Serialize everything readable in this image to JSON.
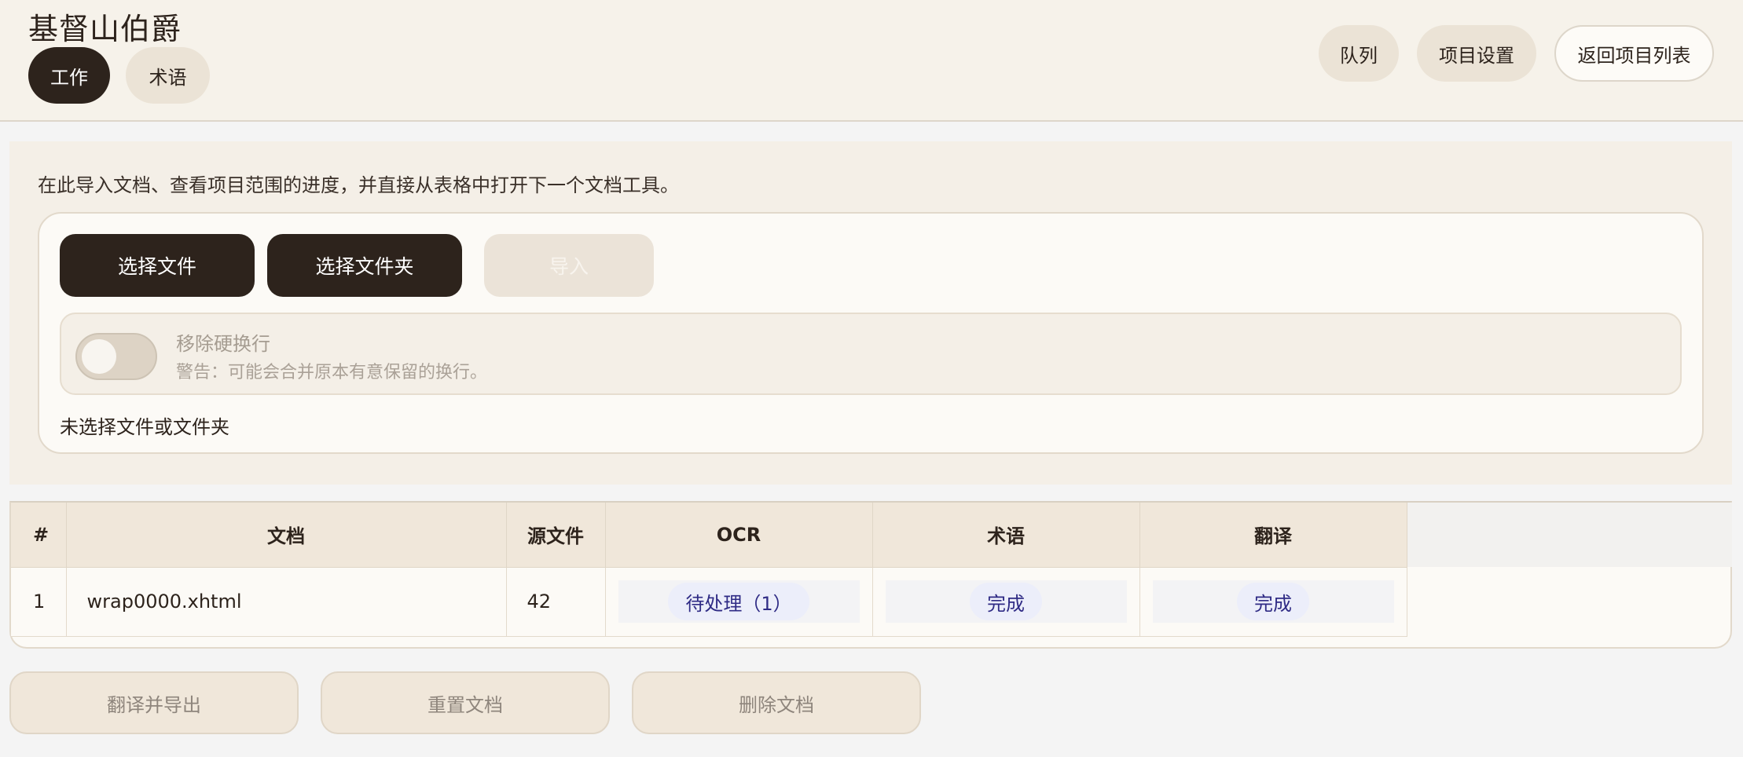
{
  "header": {
    "project_title": "基督山伯爵",
    "tabs": [
      {
        "label": "工作",
        "active": true
      },
      {
        "label": "术语",
        "active": false
      }
    ],
    "buttons": {
      "queue": "队列",
      "project_settings": "项目设置",
      "back_to_list": "返回项目列表"
    }
  },
  "import_panel": {
    "intro": "在此导入文档、查看项目范围的进度，并直接从表格中打开下一个文档工具。",
    "choose_files": "选择文件",
    "choose_folder": "选择文件夹",
    "import": "导入",
    "option": {
      "title": "移除硬换行",
      "warning": "警告：可能会合并原本有意保留的换行。",
      "enabled": false
    },
    "selection_status": "未选择文件或文件夹"
  },
  "table": {
    "columns": [
      "#",
      "文档",
      "源文件",
      "OCR",
      "术语",
      "翻译"
    ],
    "rows": [
      {
        "num": "1",
        "document": "wrap0000.xhtml",
        "source": "42",
        "ocr": "待处理（1）",
        "terms": "完成",
        "translation": "完成"
      }
    ]
  },
  "actions": {
    "translate_export": "翻译并导出",
    "reset_doc": "重置文档",
    "delete_doc": "删除文档"
  },
  "colors": {
    "primary_dark": "#2d231c",
    "header_bg": "#f6f2ea",
    "status_text": "#2f2b85",
    "status_bg": "#eceefa"
  }
}
